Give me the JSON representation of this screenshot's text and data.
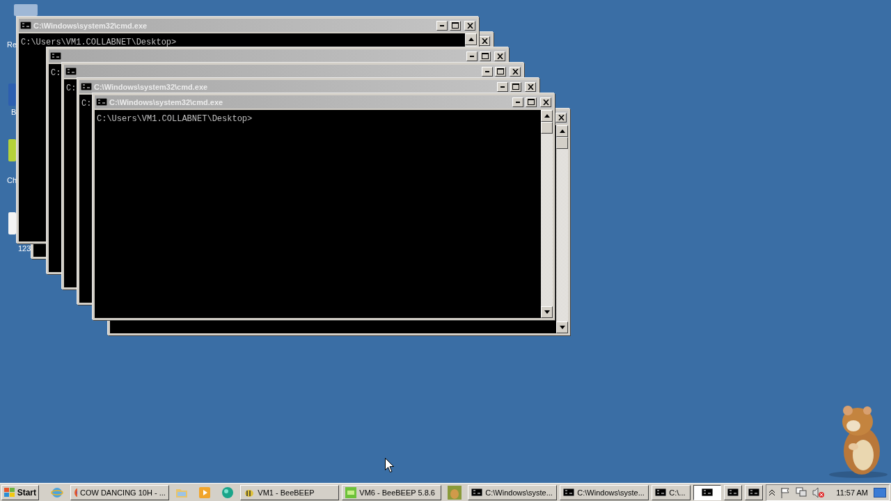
{
  "desktop_icons": [
    {
      "label": "Re"
    },
    {
      "label": "B"
    },
    {
      "label": "Ch"
    },
    {
      "label": "123"
    }
  ],
  "windows": [
    {
      "kind": "edge"
    },
    {
      "kind": "window",
      "title": "C:\\Windows\\system32\\cmd.exe",
      "line": "C:\\Users\\VM1.COLLABNET\\Desktop>"
    },
    {
      "kind": "window",
      "line": "C:"
    },
    {
      "kind": "window",
      "line": "C:"
    },
    {
      "kind": "window",
      "title": "C:\\Windows\\system32\\cmd.exe",
      "line": "C:"
    },
    {
      "kind": "edge"
    },
    {
      "kind": "window",
      "title": "C:\\Windows\\system32\\cmd.exe",
      "line": "C:\\Users\\VM1.COLLABNET\\Desktop>"
    }
  ],
  "taskbar": {
    "start": "Start",
    "items": [
      {
        "kind": "launcher"
      },
      {
        "kind": "task",
        "label": "COW DANCING 10H - ...",
        "selected": false
      },
      {
        "kind": "launcher"
      },
      {
        "kind": "launcher"
      },
      {
        "kind": "launcher"
      },
      {
        "kind": "task",
        "label": "VM1 - BeeBEEP",
        "selected": false
      },
      {
        "kind": "task",
        "label": "VM6 - BeeBEEP 5.8.6",
        "selected": false
      },
      {
        "kind": "launcher"
      },
      {
        "kind": "task",
        "label": "C:\\Windows\\syste...",
        "selected": false
      },
      {
        "kind": "task",
        "label": "C:\\Windows\\syste...",
        "selected": false
      },
      {
        "kind": "task",
        "label": "C:\\...",
        "selected": false
      },
      {
        "kind": "task",
        "selected": true
      },
      {
        "kind": "task",
        "selected": false
      },
      {
        "kind": "task",
        "selected": false
      }
    ],
    "clock": "11:57 AM"
  }
}
